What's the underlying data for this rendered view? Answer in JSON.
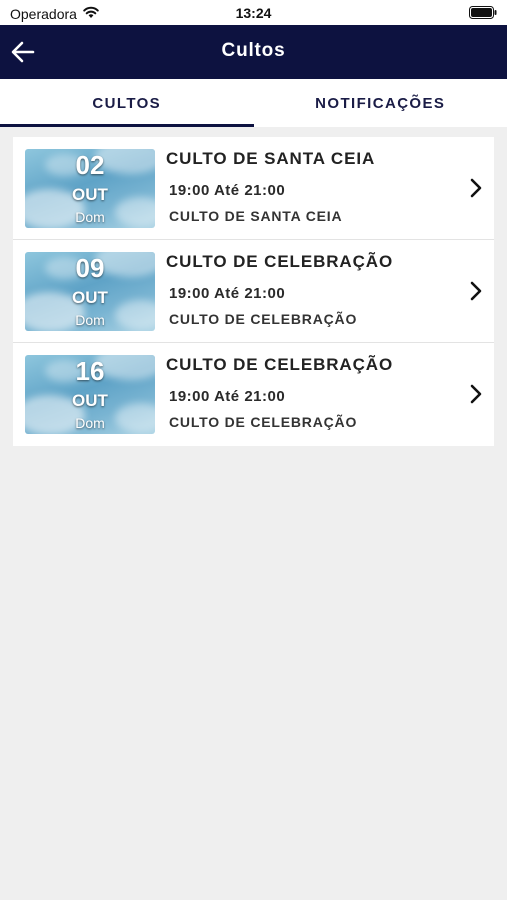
{
  "status_bar": {
    "carrier": "Operadora",
    "time": "13:24"
  },
  "header": {
    "title": "Cultos"
  },
  "tabs": [
    {
      "label": "CULTOS",
      "active": true
    },
    {
      "label": "NOTIFICAÇÕES",
      "active": false
    }
  ],
  "cultos": [
    {
      "day": "02",
      "month": "OUT",
      "weekday": "Dom",
      "name": "CULTO DE SANTA CEIA",
      "hours": "19:00 Até 21:00",
      "description": "CULTO DE SANTA CEIA"
    },
    {
      "day": "09",
      "month": "OUT",
      "weekday": "Dom",
      "name": "CULTO DE CELEBRAÇÃO",
      "hours": "19:00 Até 21:00",
      "description": "CULTO DE CELEBRAÇÃO"
    },
    {
      "day": "16",
      "month": "OUT",
      "weekday": "Dom",
      "name": "CULTO DE CELEBRAÇÃO",
      "hours": "19:00 Até 21:00",
      "description": "CULTO DE CELEBRAÇÃO"
    }
  ],
  "colors": {
    "navbar": "#0d1240",
    "background": "#efefef"
  }
}
